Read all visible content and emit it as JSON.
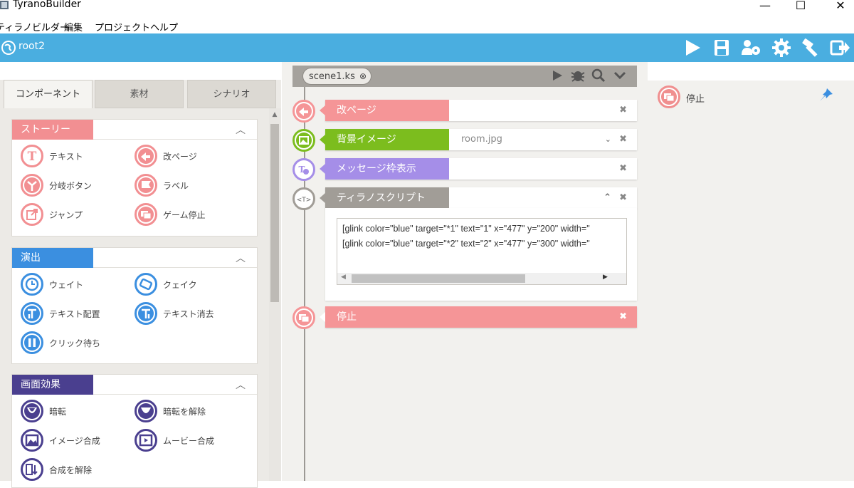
{
  "window": {
    "title": "TyranoBuilder",
    "controls": [
      "—",
      "☐",
      "✕"
    ]
  },
  "menu": [
    "ティラノビルダー",
    "編集",
    "プロジェクト",
    "ヘルプ"
  ],
  "toolbar": {
    "project_name": "root2",
    "icons": [
      "play-icon",
      "save-icon",
      "users-settings-icon",
      "gear-icon",
      "hammer-icon",
      "export-icon"
    ]
  },
  "left": {
    "tabs": [
      "コンポーネント",
      "素材",
      "シナリオ"
    ],
    "sections": [
      {
        "label": "ストーリー",
        "color": "#f28f92",
        "items": [
          "テキスト",
          "改ページ",
          "分岐ボタン",
          "ラベル",
          "ジャンプ",
          "ゲーム停止"
        ]
      },
      {
        "label": "演出",
        "color": "#3b8fe0",
        "items": [
          "ウェイト",
          "クェイク",
          "テキスト配置",
          "テキスト消去",
          "クリック待ち"
        ]
      },
      {
        "label": "画面効果",
        "color": "#4a3f8f",
        "items": [
          "暗転",
          "暗転を解除",
          "イメージ合成",
          "ムービー合成",
          "合成を解除"
        ]
      }
    ]
  },
  "scene": {
    "tab": "scene1.ks",
    "blocks": [
      {
        "label": "改ページ",
        "color": "#f59597",
        "value": ""
      },
      {
        "label": "背景イメージ",
        "color": "#7cbd1e",
        "value": "room.jpg"
      },
      {
        "label": "メッセージ枠表示",
        "color": "#a58ee8",
        "value": ""
      },
      {
        "label": "ティラノスクリプト",
        "color": "#a19d97",
        "value": ""
      },
      {
        "label": "停止",
        "color": "#f59597",
        "value": ""
      }
    ],
    "script_lines": [
      "[glink color=\"blue\" target=\"*1\" text=\"1\" x=\"477\" y=\"200\" width=\"",
      "[glink color=\"blue\" target=\"*2\" text=\"2\" x=\"477\" y=\"300\" width=\""
    ]
  },
  "right": {
    "item": "停止"
  }
}
